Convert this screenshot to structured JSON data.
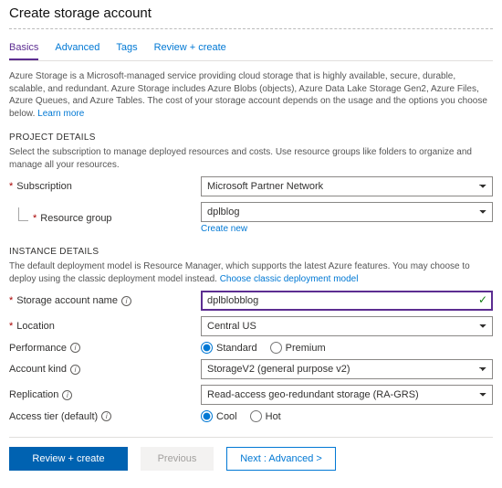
{
  "header": {
    "title": "Create storage account"
  },
  "tabs": {
    "basics": "Basics",
    "advanced": "Advanced",
    "tags": "Tags",
    "review": "Review + create"
  },
  "intro": {
    "text": "Azure Storage is a Microsoft-managed service providing cloud storage that is highly available, secure, durable, scalable, and redundant. Azure Storage includes Azure Blobs (objects), Azure Data Lake Storage Gen2, Azure Files, Azure Queues, and Azure Tables. The cost of your storage account depends on the usage and the options you choose below. ",
    "learn_more": "Learn more"
  },
  "project": {
    "heading": "PROJECT DETAILS",
    "desc": "Select the subscription to manage deployed resources and costs. Use resource groups like folders to organize and manage all your resources.",
    "subscription_label": "Subscription",
    "subscription_value": "Microsoft Partner Network",
    "rg_label": "Resource group",
    "rg_value": "dplblog",
    "create_new": "Create new"
  },
  "instance": {
    "heading": "INSTANCE DETAILS",
    "desc_prefix": "The default deployment model is Resource Manager, which supports the latest Azure features. You may choose to deploy using the classic deployment model instead. ",
    "classic_link": "Choose classic deployment model",
    "name_label": "Storage account name",
    "name_value": "dplblobblog",
    "location_label": "Location",
    "location_value": "Central US",
    "perf_label": "Performance",
    "perf_standard": "Standard",
    "perf_premium": "Premium",
    "kind_label": "Account kind",
    "kind_value": "StorageV2 (general purpose v2)",
    "repl_label": "Replication",
    "repl_value": "Read-access geo-redundant storage (RA-GRS)",
    "tier_label": "Access tier (default)",
    "tier_cool": "Cool",
    "tier_hot": "Hot"
  },
  "footer": {
    "review": "Review + create",
    "previous": "Previous",
    "next": "Next : Advanced >"
  }
}
